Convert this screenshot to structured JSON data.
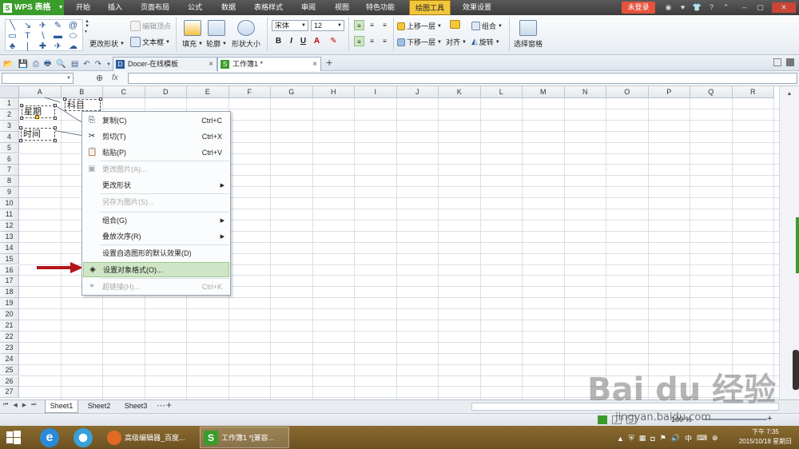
{
  "app": {
    "name": "WPS 表格",
    "logo": "S"
  },
  "menu_tabs": [
    "开始",
    "插入",
    "页面布局",
    "公式",
    "数据",
    "表格样式",
    "审阅",
    "视图",
    "特色功能",
    "绘图工具",
    "效果设置"
  ],
  "active_menu_tab": "绘图工具",
  "login_label": "未登录",
  "ribbon": {
    "edit_vertex": "编辑顶点",
    "change_shape": "更改形状",
    "text_box": "文本框",
    "fill": "填充",
    "outline": "轮廓",
    "shape_size": "形状大小",
    "font_name": "宋体",
    "font_size": "12",
    "bring_forward": "上移一层",
    "send_backward": "下移一层",
    "align": "对齐",
    "rotate": "旋转",
    "group": "组合",
    "selection_pane": "选择窗格"
  },
  "doc_tabs": [
    {
      "label": "Docer-在线模板",
      "icon": "D"
    },
    {
      "label": "工作簿1 *",
      "icon": "S"
    }
  ],
  "formula_bar": {
    "fx": "fx"
  },
  "columns": [
    "A",
    "B",
    "C",
    "D",
    "E",
    "F",
    "G",
    "H",
    "I",
    "J",
    "K",
    "L",
    "M",
    "N",
    "O",
    "P",
    "Q",
    "R"
  ],
  "rows": [
    "1",
    "2",
    "3",
    "4",
    "5",
    "6",
    "7",
    "8",
    "9",
    "10",
    "11",
    "12",
    "13",
    "14",
    "15",
    "16",
    "17",
    "18",
    "19",
    "20",
    "21",
    "22",
    "23",
    "24",
    "25",
    "26",
    "27"
  ],
  "shapes": {
    "weekday": "星期",
    "subject": "科目",
    "time": "时间"
  },
  "context_menu": [
    {
      "label": "复制(C)",
      "shortcut": "Ctrl+C",
      "icon": "copy-icon",
      "glyph": "⎘",
      "disabled": false
    },
    {
      "label": "剪切(T)",
      "shortcut": "Ctrl+X",
      "icon": "scissors-icon",
      "glyph": "✂",
      "disabled": false
    },
    {
      "label": "粘贴(P)",
      "shortcut": "Ctrl+V",
      "icon": "paste-icon",
      "glyph": "📋",
      "disabled": false
    },
    {
      "label": "更改图片(A)...",
      "shortcut": "",
      "icon": "image-icon",
      "glyph": "▣",
      "disabled": true
    },
    {
      "label": "更改形状",
      "shortcut": "",
      "submenu": true,
      "disabled": false
    },
    {
      "label": "另存为图片(S)...",
      "shortcut": "",
      "disabled": true
    },
    {
      "label": "组合(G)",
      "shortcut": "",
      "submenu": true,
      "disabled": false
    },
    {
      "label": "叠放次序(R)",
      "shortcut": "",
      "submenu": true,
      "disabled": false
    },
    {
      "label": "设置自选图形的默认效果(D)",
      "shortcut": "",
      "disabled": false
    },
    {
      "label": "设置对象格式(O)...",
      "shortcut": "",
      "icon": "format-object-icon",
      "glyph": "◈",
      "disabled": false,
      "highlighted": true
    },
    {
      "label": "超链接(H)...",
      "shortcut": "Ctrl+K",
      "icon": "link-icon",
      "glyph": "⚭",
      "disabled": true
    }
  ],
  "sheets": [
    "Sheet1",
    "Sheet2",
    "Sheet3"
  ],
  "active_sheet": "Sheet1",
  "status": {
    "zoom": "100 %"
  },
  "taskbar": {
    "apps": [
      {
        "label": "高级编辑器_百度..."
      },
      {
        "label": "工作簿1 *[兼容..."
      }
    ],
    "clock_period": "下午 7:35",
    "clock_date": "2015/10/18 星期日"
  },
  "watermark": {
    "brand": "Bai du 经验",
    "url": "jingyan.baidu.com"
  },
  "colors": {
    "wps_green": "#3a9c2b",
    "highlight_green": "#cfe6c6",
    "arrow_red": "#b3141b",
    "taskbar": "#7a5d28"
  }
}
